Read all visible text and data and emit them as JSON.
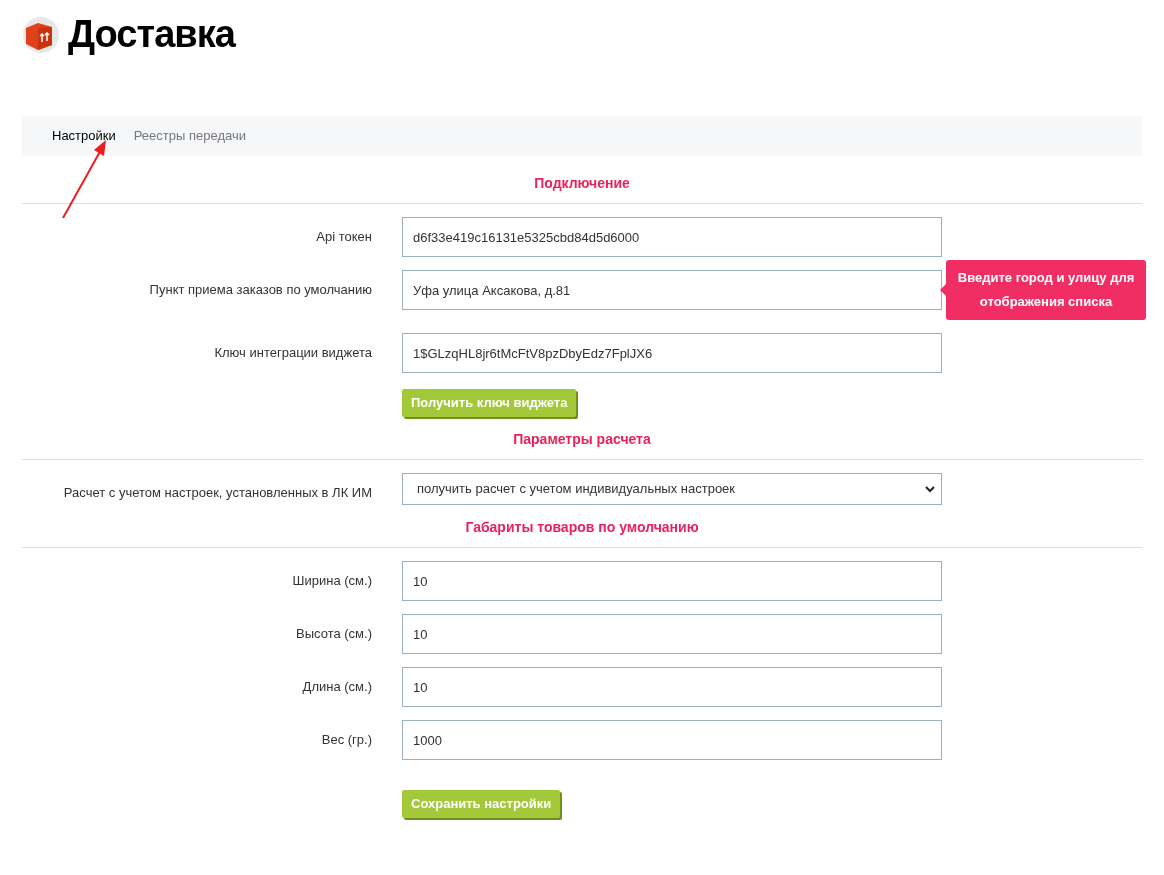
{
  "header": {
    "title": "Доставка"
  },
  "tabs": [
    {
      "label": "Настройки",
      "selected": true
    },
    {
      "label": "Реестры передачи",
      "selected": false
    }
  ],
  "sections": [
    {
      "title": "Подключение",
      "rows": [
        {
          "kind": "input",
          "label": "Api токен",
          "value": "d6f33e419c16131e5325cbd84d5d6000"
        },
        {
          "kind": "input",
          "label": "Пункт приема заказов по умолчанию",
          "value": "Уфа улица Аксакова, д.81",
          "tooltip": "Введите город и улицу для отображения списка"
        },
        {
          "kind": "input",
          "label": "Ключ интеграции виджета",
          "value": "1$GLzqHL8jr6tMcFtV8pzDbyEdz7FplJX6"
        }
      ],
      "button": "Получить ключ виджета"
    },
    {
      "title": "Параметры расчета",
      "rows": [
        {
          "kind": "select",
          "label": "Расчет с учетом настроек, установленных в ЛК ИМ",
          "value": "получить расчет с учетом индивидуальных настроек"
        }
      ]
    },
    {
      "title": "Габариты товаров по умолчанию",
      "rows": [
        {
          "kind": "input",
          "label": "Ширина (см.)",
          "value": "10"
        },
        {
          "kind": "input",
          "label": "Высота (см.)",
          "value": "10"
        },
        {
          "kind": "input",
          "label": "Длина (см.)",
          "value": "10"
        },
        {
          "kind": "input",
          "label": "Вес (гр.)",
          "value": "1000"
        }
      ]
    }
  ],
  "save_button": "Сохранить настройки"
}
